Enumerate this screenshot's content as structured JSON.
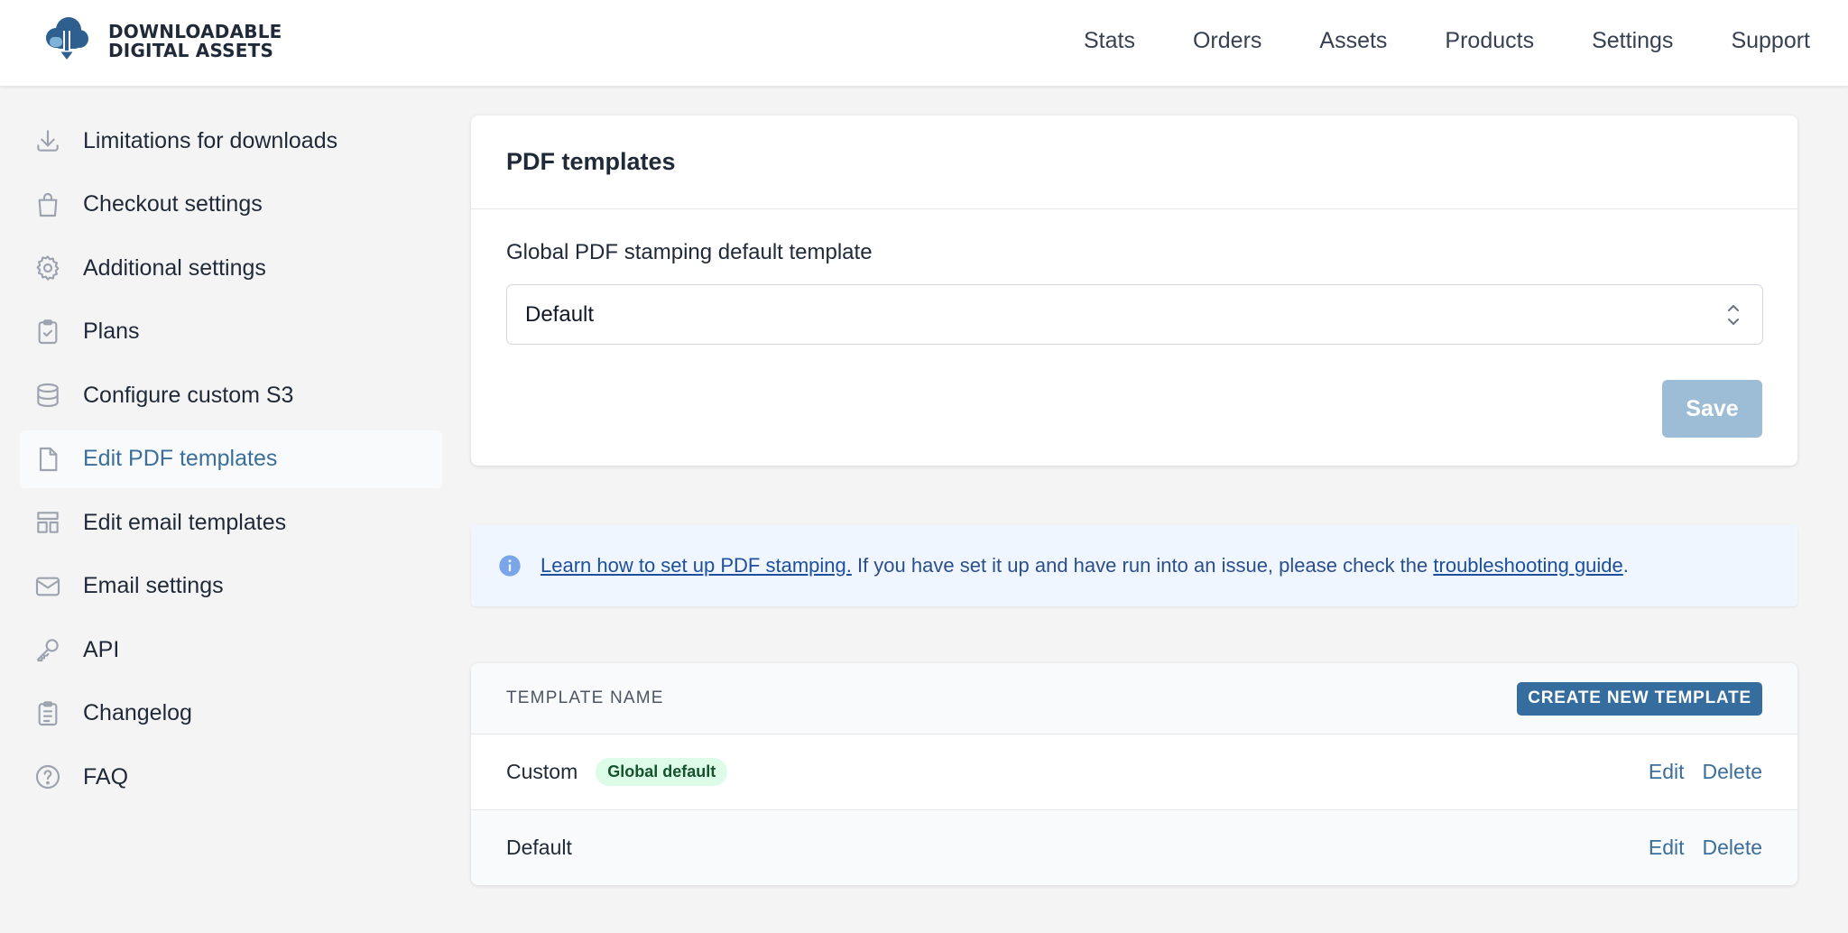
{
  "brand": {
    "line1": "DOWNLOADABLE",
    "line2": "DIGITAL ASSETS",
    "accent": "#3b6f9a"
  },
  "nav": {
    "items": [
      "Stats",
      "Orders",
      "Assets",
      "Products",
      "Settings",
      "Support"
    ]
  },
  "sidebar": {
    "items": [
      {
        "label": "Limitations for downloads",
        "icon": "download-icon"
      },
      {
        "label": "Checkout settings",
        "icon": "shopping-bag-icon"
      },
      {
        "label": "Additional settings",
        "icon": "gear-icon"
      },
      {
        "label": "Plans",
        "icon": "clipboard-check-icon"
      },
      {
        "label": "Configure custom S3",
        "icon": "database-icon"
      },
      {
        "label": "Edit PDF templates",
        "icon": "document-icon",
        "active": true
      },
      {
        "label": "Edit email templates",
        "icon": "template-icon"
      },
      {
        "label": "Email settings",
        "icon": "mail-icon"
      },
      {
        "label": "API",
        "icon": "key-icon"
      },
      {
        "label": "Changelog",
        "icon": "clipboard-list-icon"
      },
      {
        "label": "FAQ",
        "icon": "question-circle-icon"
      }
    ]
  },
  "pdf_card": {
    "title": "PDF templates",
    "field_label": "Global PDF stamping default template",
    "select_value": "Default",
    "save_label": "Save"
  },
  "info": {
    "link1": "Learn how to set up PDF stamping.",
    "text": " If you have set it up and have run into an issue, please check the ",
    "link2": "troubleshooting guide",
    "suffix": "."
  },
  "table": {
    "column_header": "TEMPLATE NAME",
    "create_label": "CREATE NEW TEMPLATE",
    "rows": [
      {
        "name": "Custom",
        "badge": "Global default",
        "edit": "Edit",
        "delete": "Delete"
      },
      {
        "name": "Default",
        "edit": "Edit",
        "delete": "Delete"
      }
    ]
  }
}
